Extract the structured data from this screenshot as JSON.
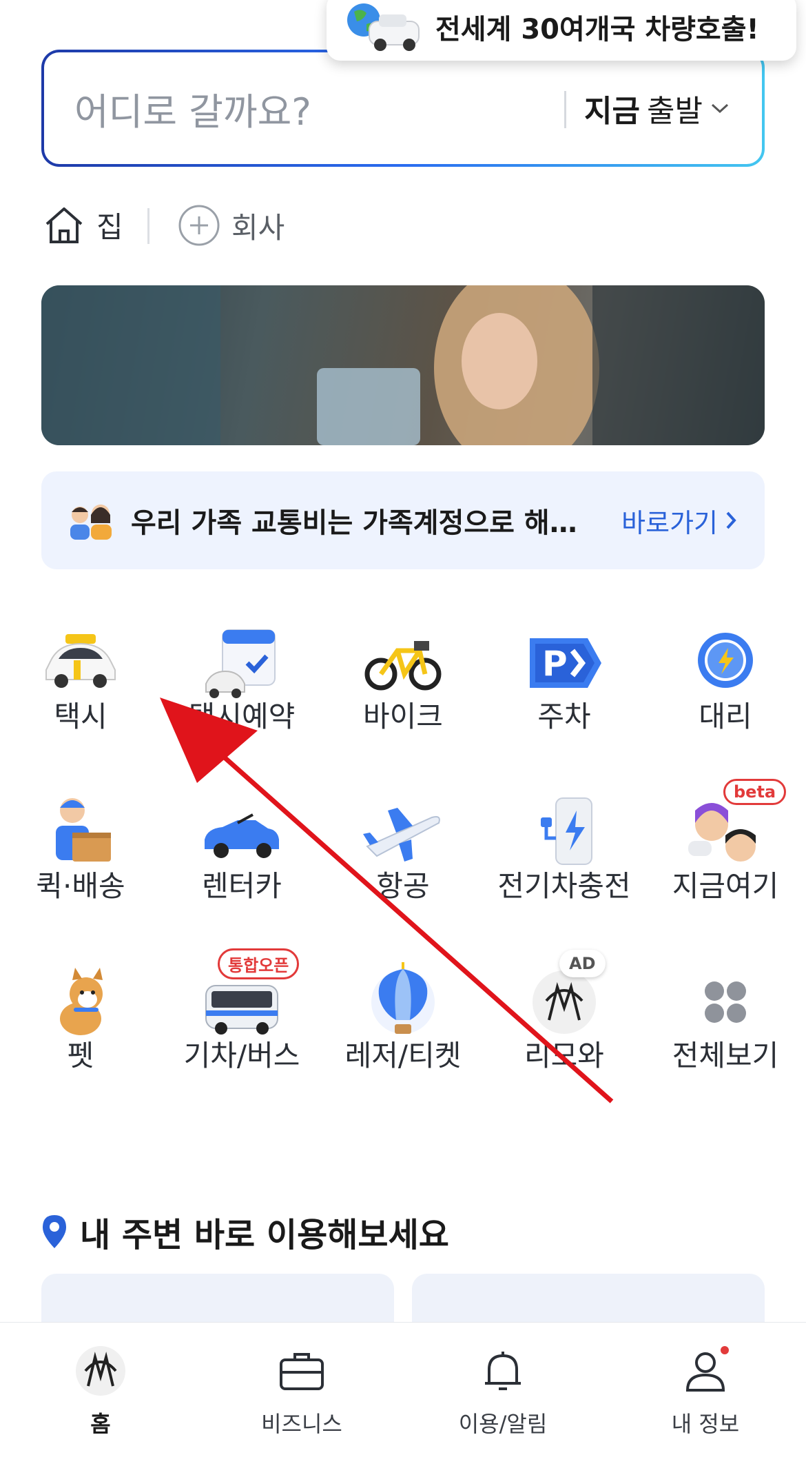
{
  "toast": {
    "text": "전세계 30여개국 차량호출!"
  },
  "search": {
    "placeholder": "어디로 갈까요?",
    "depart_bold": "지금",
    "depart_rest": "출발"
  },
  "shortcuts": [
    {
      "label": "집"
    },
    {
      "label": "회사"
    }
  ],
  "promo": {
    "text": "우리 가족 교통비는 가족계정으로 해…",
    "link": "바로가기"
  },
  "services": [
    {
      "label": "택시"
    },
    {
      "label": "택시예약"
    },
    {
      "label": "바이크"
    },
    {
      "label": "주차"
    },
    {
      "label": "대리"
    },
    {
      "label": "퀵·배송"
    },
    {
      "label": "렌터카"
    },
    {
      "label": "항공"
    },
    {
      "label": "전기차충전"
    },
    {
      "label": "지금여기",
      "badge": "beta"
    },
    {
      "label": "펫"
    },
    {
      "label": "기차/버스",
      "badge": "통합오픈"
    },
    {
      "label": "레저/티켓"
    },
    {
      "label": "리모와",
      "badge": "AD"
    },
    {
      "label": "전체보기"
    }
  ],
  "nearby": {
    "title": "내 주변 바로 이용해보세요"
  },
  "nav": [
    {
      "label": "홈",
      "active": true
    },
    {
      "label": "비즈니스"
    },
    {
      "label": "이용/알림"
    },
    {
      "label": "내 정보"
    }
  ],
  "colors": {
    "accent": "#2a62d9",
    "badge_red": "#e23a3a",
    "arrow": "#e0141b"
  }
}
